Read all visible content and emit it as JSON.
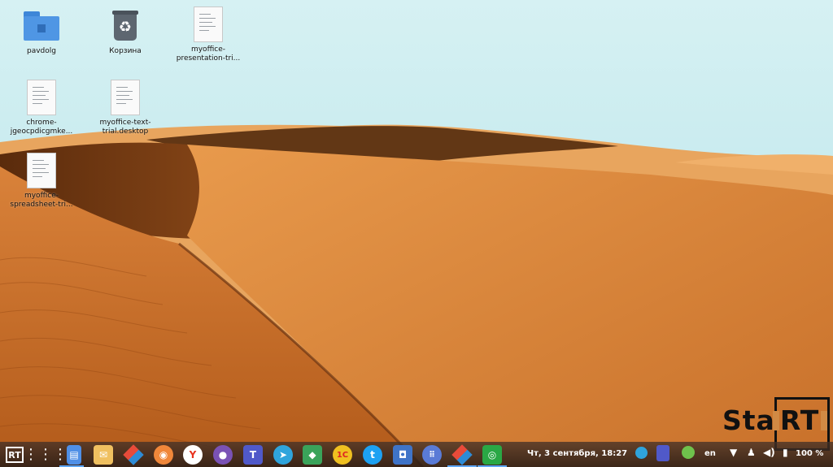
{
  "desktop": {
    "icons": [
      {
        "label": "pavdolg",
        "icon": "home-folder-icon"
      },
      {
        "label": "Корзина",
        "icon": "trash-icon"
      },
      {
        "label": "myoffice-presentation-tri...",
        "icon": "desktop-file-icon"
      },
      {
        "label": "chrome-jgeocpdicgmke...",
        "icon": "desktop-file-icon"
      },
      {
        "label": "myoffice-text-trial.desktop",
        "icon": "desktop-file-icon"
      },
      {
        "label": "myoffice-spreadsheet-tri...",
        "icon": "desktop-file-icon"
      }
    ],
    "logo": {
      "text_left": "Sta",
      "text_boxed": "RT"
    }
  },
  "taskbar": {
    "start_icon": "rt-logo-icon",
    "apps": [
      {
        "name": "app-grid-icon",
        "color": "#ffffff"
      },
      {
        "name": "file-manager-icon",
        "color": "#4f8fe6"
      },
      {
        "name": "mail-icon",
        "color": "#f0c060"
      },
      {
        "name": "myoffice-icon",
        "color": "#e84b3a"
      },
      {
        "name": "firefox-icon",
        "color": "#f0873a"
      },
      {
        "name": "yandex-browser-icon",
        "color": "#e8321e"
      },
      {
        "name": "pidgin-icon",
        "color": "#7a52b5"
      },
      {
        "name": "teams-icon",
        "color": "#5059c9"
      },
      {
        "name": "telegram-icon",
        "color": "#2fa4dc"
      },
      {
        "name": "maps-icon",
        "color": "#3aa35a"
      },
      {
        "name": "1c-icon",
        "color": "#f0c020"
      },
      {
        "name": "twitter-icon",
        "color": "#1da1f2"
      },
      {
        "name": "screenshot-icon",
        "color": "#3f74c8"
      },
      {
        "name": "apps-icon",
        "color": "#5a7bd6"
      },
      {
        "name": "myoffice-icon",
        "color": "#e84b3a"
      },
      {
        "name": "chrome-app-icon",
        "color": "#2aa845"
      }
    ],
    "clock": "Чт, 3 сентября, 18:27",
    "keyboard_layout": "en",
    "battery": "100 %",
    "tray_icons": [
      "telegram-tray-icon",
      "teams-tray-icon",
      "update-icon",
      "wifi-icon",
      "vpn-icon",
      "volume-icon",
      "battery-icon"
    ]
  }
}
